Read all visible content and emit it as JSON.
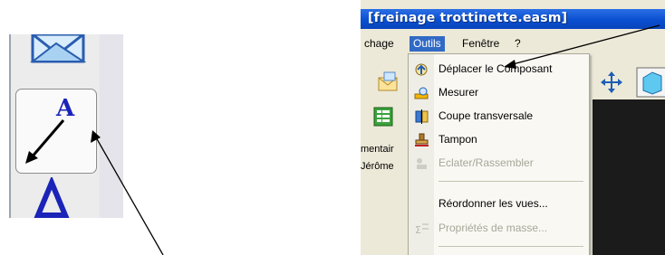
{
  "app": {
    "title": "[freinage trottinette.easm]"
  },
  "menubar": {
    "items": [
      {
        "label": "chage"
      },
      {
        "label": "Outils"
      },
      {
        "label": "Fenêtre"
      },
      {
        "label": "?"
      }
    ]
  },
  "dropdown": {
    "items": [
      {
        "label": "Déplacer le Composant",
        "icon": "move-component-icon",
        "enabled": true
      },
      {
        "label": "Mesurer",
        "icon": "measure-icon",
        "enabled": true
      },
      {
        "label": "Coupe transversale",
        "icon": "cross-section-icon",
        "enabled": true
      },
      {
        "label": "Tampon",
        "icon": "stamp-icon",
        "enabled": true
      },
      {
        "label": "Eclater/Rassembler",
        "icon": "explode-icon",
        "enabled": false
      },
      {
        "label": "Réordonner les vues...",
        "icon": "",
        "enabled": true
      },
      {
        "label": "Propriétés de masse...",
        "icon": "mass-properties-icon",
        "enabled": false
      }
    ]
  },
  "behind_menu": {
    "line1": "mentair",
    "line2": "Jérôme"
  },
  "colors": {
    "title_bar": "#0a4fd0",
    "menu_highlight": "#316ac5",
    "annotation_icon": "#1a24b8"
  }
}
